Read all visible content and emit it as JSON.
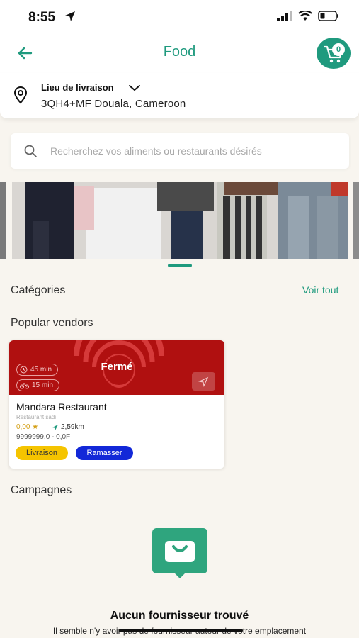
{
  "status_bar": {
    "time": "8:55"
  },
  "header": {
    "title": "Food",
    "cart_count": "0"
  },
  "delivery": {
    "label": "Lieu de livraison",
    "address": "3QH4+MF Douala, Cameroon"
  },
  "search": {
    "placeholder": "Recherchez vos aliments ou restaurants désirés"
  },
  "sections": {
    "categories_title": "Catégories",
    "see_all": "Voir tout",
    "popular_vendors_title": "Popular vendors",
    "campaigns_title": "Campagnes"
  },
  "vendor": {
    "status": "Fermé",
    "delivery_time": "45 min",
    "bike_time": "15 min",
    "name": "Mandara Restaurant",
    "subtitle": "Restaurant sadi",
    "rating": "0,00 ★",
    "distance": "2,59km",
    "price": "9999999,0 - 0,0F",
    "tag_delivery": "Livraison",
    "tag_pickup": "Ramasser",
    "cover_color": "#b01010"
  },
  "empty_state": {
    "title": "Aucun fournisseur trouvé",
    "subtitle": "Il semble n'y avoir pas de fournisseur autour de votre emplacement"
  },
  "colors": {
    "accent": "#1f9a7e",
    "background": "#f8f5ef",
    "tag_delivery": "#f5c400",
    "tag_pickup": "#1228d8"
  }
}
